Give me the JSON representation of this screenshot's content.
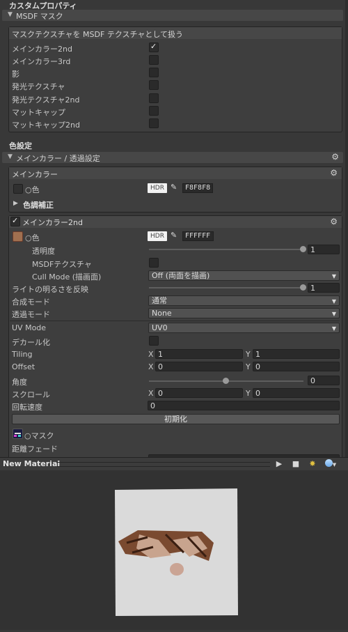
{
  "custom_properties": {
    "title": "カスタムプロパティ",
    "msdf_section": {
      "label": "MSDF マスク",
      "box_title": "マスクテクスチャを MSDF テクスチャとして扱う",
      "items": [
        {
          "label": "メインカラー2nd",
          "checked": true
        },
        {
          "label": "メインカラー3rd",
          "checked": false
        },
        {
          "label": "影",
          "checked": false
        },
        {
          "label": "発光テクスチャ",
          "checked": false
        },
        {
          "label": "発光テクスチャ2nd",
          "checked": false
        },
        {
          "label": "マットキャップ",
          "checked": false
        },
        {
          "label": "マットキャップ2nd",
          "checked": false
        }
      ]
    }
  },
  "color_settings": {
    "title": "色設定",
    "main_transparency": {
      "label": "メインカラー / 透過設定"
    },
    "main_color": {
      "label": "メインカラー",
      "color_label": "○色",
      "hdr": "HDR",
      "hex": "F8F8F8",
      "color_correction": "色調補正"
    },
    "main_color_2nd": {
      "label": "メインカラー2nd",
      "enabled": true,
      "color_label": "○色",
      "hdr": "HDR",
      "hex": "FFFFFF",
      "opacity_label": "透明度",
      "opacity_value": "1",
      "opacity_level": 1.0,
      "msdf_label": "MSDFテクスチャ",
      "cull_label": "Cull Mode (描画面)",
      "cull_value": "Off (両面を描画)",
      "light_label": "ライトの明るさを反映",
      "light_value": "1",
      "light_level": 1.0,
      "blend_label": "合成モード",
      "blend_value": "通常",
      "transparency_label": "透過モード",
      "transparency_value": "None",
      "uv_label": "UV Mode",
      "uv_value": "UV0",
      "decal_label": "デカール化",
      "tiling_label": "Tiling",
      "tiling_x": "1",
      "tiling_y": "1",
      "offset_label": "Offset",
      "offset_x": "0",
      "offset_y": "0",
      "angle_label": "角度",
      "angle_value": "0",
      "angle_level": 0.5,
      "scroll_label": "スクロール",
      "scroll_x": "0",
      "scroll_y": "0",
      "rotation_label": "回転速度",
      "rotation_value": "0",
      "reset_button": "初期化",
      "mask_label": "○マスク",
      "distance_fade_label": "距離フェード",
      "x_label": "X",
      "y_label": "Y"
    }
  },
  "preview": {
    "title": "New Material",
    "icons": [
      "play-icon",
      "stop-icon",
      "lighting-icon",
      "sphere-icon"
    ]
  },
  "colors": {
    "panel_bg": "#383838",
    "header_bg": "#474747",
    "swatch_f8": "#F8F8F8",
    "swatch_ff": "#FFFFFF"
  }
}
